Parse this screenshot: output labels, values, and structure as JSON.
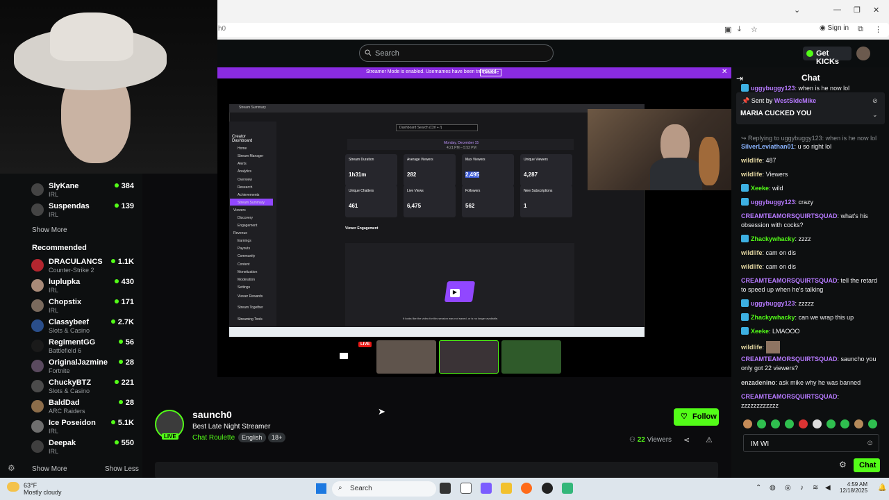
{
  "browser": {
    "address_fragment": "h0",
    "sign_in": "Sign in",
    "window_controls": [
      "chevron-down",
      "minimize",
      "restore",
      "close"
    ]
  },
  "header": {
    "search_placeholder": "Search",
    "get_kicks": "Get KICKs"
  },
  "banner": {
    "text": "Streamer Mode is enabled. Usernames have been truncated.",
    "disable": "Disable"
  },
  "sidebar": {
    "following": [
      {
        "name": "SlyKane",
        "category": "IRL",
        "viewers": "384"
      },
      {
        "name": "Suspendas",
        "category": "IRL",
        "viewers": "139"
      }
    ],
    "show_more_following": "Show More",
    "recommended_title": "Recommended",
    "recommended": [
      {
        "name": "DRACULANCS",
        "category": "Counter-Strike 2",
        "viewers": "1.1K"
      },
      {
        "name": "luplupka",
        "category": "IRL",
        "viewers": "430"
      },
      {
        "name": "Chopstix",
        "category": "IRL",
        "viewers": "171"
      },
      {
        "name": "Classybeef",
        "category": "Slots & Casino",
        "viewers": "2.7K"
      },
      {
        "name": "RegimentGG",
        "category": "Battlefield 6",
        "viewers": "56"
      },
      {
        "name": "OriginalJazmine",
        "category": "Fortnite",
        "viewers": "28"
      },
      {
        "name": "ChuckyBTZ",
        "category": "Slots & Casino",
        "viewers": "221"
      },
      {
        "name": "BaldDad",
        "category": "ARC Raiders",
        "viewers": "28"
      },
      {
        "name": "Ice Poseidon",
        "category": "IRL",
        "viewers": "5.1K"
      },
      {
        "name": "Deepak",
        "category": "IRL",
        "viewers": "550"
      }
    ],
    "show_more": "Show More",
    "show_less": "Show Less"
  },
  "inner_screen": {
    "page_title": "Stream Summary",
    "dashboard_label": "Creator Dashboard",
    "search": "Dashboard Search (Ctrl + /)",
    "date": "Monday, December 15",
    "time_range": "4:21 PM – 5:52 PM",
    "nav": [
      "Home",
      "Stream Manager",
      "Alerts",
      "Analytics",
      "Overview",
      "Research",
      "Achievements",
      "Stream Summary",
      "Viewers",
      "Discovery",
      "Engagement",
      "Revenue",
      "Earnings",
      "Payouts",
      "Community",
      "Content",
      "Monetization",
      "Moderation",
      "Settings",
      "Viewer Rewards",
      "Stream Together",
      "Streaming Tools"
    ],
    "stats": [
      {
        "title": "Stream Duration",
        "value": "1h31m"
      },
      {
        "title": "Average Viewers",
        "value": "282"
      },
      {
        "title": "Max Viewers",
        "value": "2,495"
      },
      {
        "title": "Unique Viewers",
        "value": "4,287"
      },
      {
        "title": "Unique Chatters",
        "value": "461"
      },
      {
        "title": "Live Views",
        "value": "6,475"
      },
      {
        "title": "Followers",
        "value": "562"
      },
      {
        "title": "New Subscriptions",
        "value": "1"
      }
    ],
    "engagement_title": "Viewer Engagement",
    "no_vod": "It looks like the video for this session was not saved, or is no longer available."
  },
  "thumbnails": {
    "live_label": "LIVE"
  },
  "channel": {
    "name": "saunch0",
    "title": "Best Late Night Streamer",
    "category": "Chat Roulette",
    "tags": [
      "English",
      "18+"
    ],
    "live_label": "LIVE",
    "follow": "Follow",
    "viewer_count": "22",
    "viewers_label": "Viewers"
  },
  "chat": {
    "title": "Chat",
    "pinned_by_label": "Sent by",
    "pinned_by": "WestSideMike",
    "pinned_message": "MARIA CUCKED YOU",
    "messages": [
      {
        "user": "uggybuggy123",
        "text": "when is he now lol",
        "color": "b"
      },
      {
        "user": "",
        "text": "Replying to uggybuggy123: when is he now lol",
        "color": "reply"
      },
      {
        "user": "SilverLeviathan01",
        "text": "u so right lol",
        "color": "b"
      },
      {
        "user": "wildlife",
        "text": "487",
        "color": "y"
      },
      {
        "user": "wildlife",
        "text": "Viewers",
        "color": "y"
      },
      {
        "user": "Xeeke",
        "text": "wild",
        "color": "g"
      },
      {
        "user": "uggybuggy123",
        "text": "crazy",
        "color": "p"
      },
      {
        "user": "CREAMTEAMORSQUIRTSQUAD",
        "text": "what's his obsession with cocks?",
        "color": "p"
      },
      {
        "user": "Zhackywhacky",
        "text": "zzzz",
        "color": "g"
      },
      {
        "user": "wildlife",
        "text": "cam on dis",
        "color": "y"
      },
      {
        "user": "wildlife",
        "text": "cam on dis",
        "color": "y"
      },
      {
        "user": "CREAMTEAMORSQUIRTSQUAD",
        "text": "tell the retard to speed up when he's talking",
        "color": "p"
      },
      {
        "user": "uggybuggy123",
        "text": "zzzzz",
        "color": "p"
      },
      {
        "user": "Zhackywhacky",
        "text": "can we wrap this up",
        "color": "g"
      },
      {
        "user": "Xeeke",
        "text": "LMAOOO",
        "color": "g"
      },
      {
        "user": "wildlife",
        "text": "",
        "color": "y"
      },
      {
        "user": "CREAMTEAMORSQUIRTSQUAD",
        "text": "sauncho you only got 22 viewers?",
        "color": "p"
      },
      {
        "user": "enzadenino",
        "text": "ask mike why he was banned",
        "color": "w"
      },
      {
        "user": "CREAMTEAMORSQUIRTSQUAD",
        "text": "zzzzzzzzzzzz",
        "color": "p"
      }
    ],
    "input_value": "IM WI",
    "send": "Chat"
  },
  "taskbar": {
    "temp": "63°F",
    "weather": "Mostly cloudy",
    "search": "Search",
    "time": "4:59 AM",
    "date": "12/18/2025"
  }
}
